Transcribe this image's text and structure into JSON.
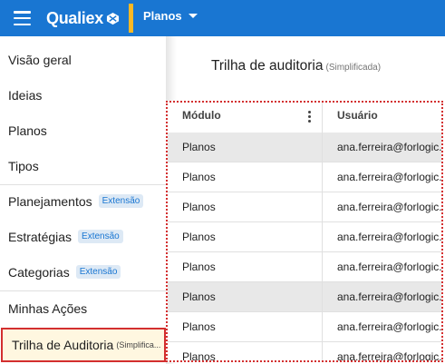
{
  "header": {
    "brand": "Qualiex",
    "module": "Planos",
    "colors": {
      "bar": "#1976d2",
      "accent": "#f9b825"
    }
  },
  "sidebar": {
    "items": [
      {
        "label": "Visão geral",
        "badge": ""
      },
      {
        "label": "Ideias",
        "badge": ""
      },
      {
        "label": "Planos",
        "badge": ""
      },
      {
        "label": "Tipos",
        "badge": ""
      },
      {
        "label": "Planejamentos",
        "badge": "Extensão"
      },
      {
        "label": "Estratégias",
        "badge": "Extensão"
      },
      {
        "label": "Categorias",
        "badge": "Extensão"
      },
      {
        "label": "Minhas Ações",
        "badge": ""
      },
      {
        "label": "Trilha de Auditoria",
        "sub": "(Simplifica...",
        "active": true
      }
    ]
  },
  "main": {
    "title": "Trilha de auditoria",
    "subtitle": "(Simplificada)",
    "grid": {
      "columns": [
        "Módulo",
        "Usuário"
      ],
      "rows": [
        {
          "modulo": "Planos",
          "usuario": "ana.ferreira@forlogic.net",
          "shaded": true
        },
        {
          "modulo": "Planos",
          "usuario": "ana.ferreira@forlogic.net",
          "shaded": false
        },
        {
          "modulo": "Planos",
          "usuario": "ana.ferreira@forlogic.net",
          "shaded": false
        },
        {
          "modulo": "Planos",
          "usuario": "ana.ferreira@forlogic.net",
          "shaded": false
        },
        {
          "modulo": "Planos",
          "usuario": "ana.ferreira@forlogic.net",
          "shaded": false
        },
        {
          "modulo": "Planos",
          "usuario": "ana.ferreira@forlogic.net",
          "shaded": true
        },
        {
          "modulo": "Planos",
          "usuario": "ana.ferreira@forlogic.net",
          "shaded": false
        },
        {
          "modulo": "Planos",
          "usuario": "ana.ferreira@forlogic.net",
          "shaded": false
        }
      ]
    }
  }
}
